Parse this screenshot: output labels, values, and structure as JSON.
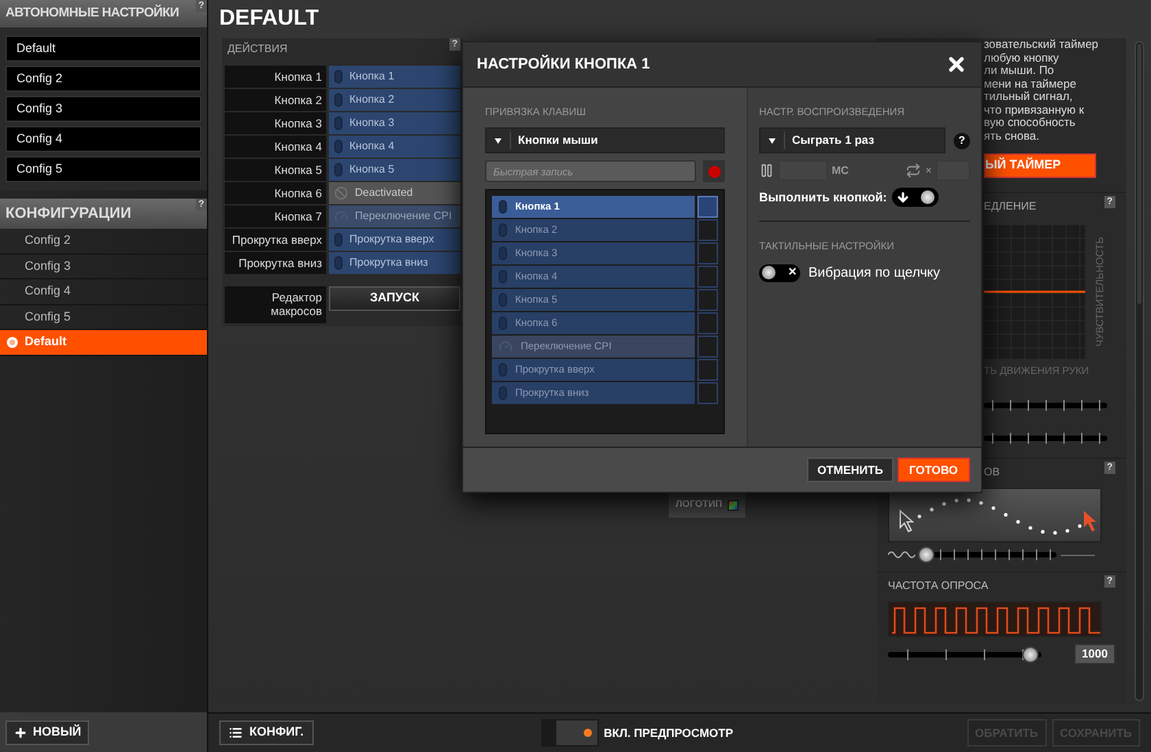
{
  "sidebar": {
    "onboard_title": "АВТОНОМНЫЕ НАСТРОЙКИ",
    "onboard_help": "?",
    "onboard_items": [
      {
        "label": "Default"
      },
      {
        "label": "Config 2"
      },
      {
        "label": "Config 3"
      },
      {
        "label": "Config 4"
      },
      {
        "label": "Config 5"
      }
    ],
    "configs_title": "КОНФИГУРАЦИИ",
    "configs_help": "?",
    "config_items": [
      {
        "label": "Config 2",
        "selected": false
      },
      {
        "label": "Config 3",
        "selected": false
      },
      {
        "label": "Config 4",
        "selected": false
      },
      {
        "label": "Config 5",
        "selected": false
      },
      {
        "label": "Default",
        "selected": true
      }
    ],
    "new_button": "НОВЫЙ"
  },
  "page_title": "DEFAULT",
  "actions": {
    "title": "ДЕЙСТВИЯ",
    "help": "?",
    "rows": [
      {
        "label": "Кнопка 1",
        "binding": "Кнопка 1",
        "kind": "mouse"
      },
      {
        "label": "Кнопка 2",
        "binding": "Кнопка 2",
        "kind": "mouse"
      },
      {
        "label": "Кнопка 3",
        "binding": "Кнопка 3",
        "kind": "mouse"
      },
      {
        "label": "Кнопка 4",
        "binding": "Кнопка 4",
        "kind": "mouse"
      },
      {
        "label": "Кнопка 5",
        "binding": "Кнопка 5",
        "kind": "mouse"
      },
      {
        "label": "Кнопка 6",
        "binding": "Deactivated",
        "kind": "deactivated"
      },
      {
        "label": "Кнопка 7",
        "binding": "Переключение CPI",
        "kind": "cpi"
      },
      {
        "label": "Прокрутка вверх",
        "binding": "Прокрутка вверх",
        "kind": "mouse"
      },
      {
        "label": "Прокрутка вниз",
        "binding": "Прокрутка вниз",
        "kind": "mouse"
      }
    ],
    "macro_label": "Редактор макросов",
    "macro_button": "ЗАПУСК"
  },
  "logo_chip": "ЛОГОТИП",
  "right_panel": {
    "text_lines": [
      "зовательский таймер",
      "любую кнопку",
      "ли мыши. По",
      "мени на таймере",
      "тильный сигнал,",
      "что привязанную к",
      "вую способность",
      "ять снова."
    ],
    "timer_button": "ЫЙ ТАЙМЕР",
    "accel": {
      "title": "ЕДЛЕНИЕ",
      "help": "?",
      "axis_label": "ЧУВСТВИТЕЛЬНОСТЬ",
      "caption": "ТЬ ДВИЖЕНИЯ РУКИ"
    },
    "angle": {
      "title": "ОВ",
      "help": "?",
      "level": 0.05
    },
    "polling": {
      "title": "ЧАСТОТА ОПРОСА",
      "help": "?",
      "level": 0.93,
      "value": "1000"
    }
  },
  "modal": {
    "title": "НАСТРОЙКИ КНОПКА 1",
    "binding": {
      "title": "ПРИВЯЗКА КЛАВИШ",
      "dropdown": "Кнопки мыши",
      "quick_record_placeholder": "Быстрая запись",
      "items": [
        {
          "label": "Кнопка 1",
          "selected": true,
          "kind": "mouse"
        },
        {
          "label": "Кнопка 2",
          "selected": false,
          "kind": "mouse"
        },
        {
          "label": "Кнопка 3",
          "selected": false,
          "kind": "mouse"
        },
        {
          "label": "Кнопка 4",
          "selected": false,
          "kind": "mouse"
        },
        {
          "label": "Кнопка 5",
          "selected": false,
          "kind": "mouse"
        },
        {
          "label": "Кнопка 6",
          "selected": false,
          "kind": "mouse"
        },
        {
          "label": "Переключение CPI",
          "selected": false,
          "kind": "cpi"
        },
        {
          "label": "Прокрутка вверх",
          "selected": false,
          "kind": "mouse"
        },
        {
          "label": "Прокрутка вниз",
          "selected": false,
          "kind": "mouse"
        }
      ]
    },
    "playback": {
      "title": "НАСТР. ВОСПРОИЗВЕДЕНИЯ",
      "dropdown": "Сыграть 1 раз",
      "help": "?",
      "delay_unit": "МС",
      "repeat_x": "×",
      "execute_label": "Выполнить кнопкой:",
      "execute_on": true
    },
    "haptic": {
      "title": "ТАКТИЛЬНЫЕ НАСТРОЙКИ",
      "vibration_label": "Вибрация по щелчку",
      "vibration_on": false,
      "off_mark": "✕"
    },
    "cancel_button": "ОТМЕНИТЬ",
    "done_button": "ГОТОВО"
  },
  "bottom_bar": {
    "config_button": "КОНФИГ.",
    "preview_label": "ВКЛ. ПРЕДПРОСМОТР",
    "preview_on": true,
    "revert_button": {
      "label": "ОБРАТИТЬ",
      "disabled": true
    },
    "save_button": {
      "label": "СОХРАНИТЬ",
      "disabled": true
    }
  }
}
